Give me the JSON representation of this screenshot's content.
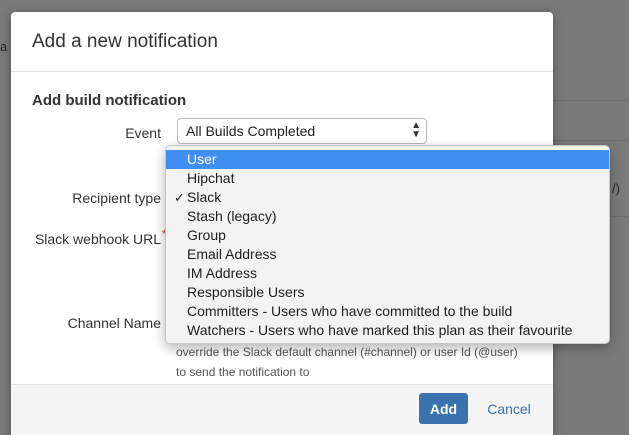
{
  "background": {
    "left_fragment": "a",
    "right_fragment": "/)"
  },
  "dialog": {
    "title": "Add a new notification",
    "section_title": "Add build notification",
    "fields": {
      "event_label": "Event",
      "event_value": "All Builds Completed",
      "recipient_type_label": "Recipient type",
      "slack_webhook_label": "Slack webhook URL",
      "required_mark": "*",
      "channel_name_label": "Channel Name",
      "channel_help_line1": "override the Slack default channel (#channel) or user Id (@user)",
      "channel_help_line2": "to send the notification to"
    },
    "buttons": {
      "add": "Add",
      "cancel": "Cancel"
    }
  },
  "dropdown": {
    "check_glyph": "✓",
    "items": [
      {
        "label": "User",
        "highlighted": true,
        "checked": false
      },
      {
        "label": "Hipchat",
        "highlighted": false,
        "checked": false
      },
      {
        "label": "Slack",
        "highlighted": false,
        "checked": true
      },
      {
        "label": "Stash (legacy)",
        "highlighted": false,
        "checked": false
      },
      {
        "label": "Group",
        "highlighted": false,
        "checked": false
      },
      {
        "label": "Email Address",
        "highlighted": false,
        "checked": false
      },
      {
        "label": "IM Address",
        "highlighted": false,
        "checked": false
      },
      {
        "label": "Responsible Users",
        "highlighted": false,
        "checked": false
      },
      {
        "label": "Committers - Users who have committed to the build",
        "highlighted": false,
        "checked": false
      },
      {
        "label": "Watchers - Users who have marked this plan as their favourite",
        "highlighted": false,
        "checked": false
      }
    ]
  },
  "colors": {
    "primary": "#3b73af",
    "highlight": "#3f8ef2",
    "required": "#d04437"
  }
}
